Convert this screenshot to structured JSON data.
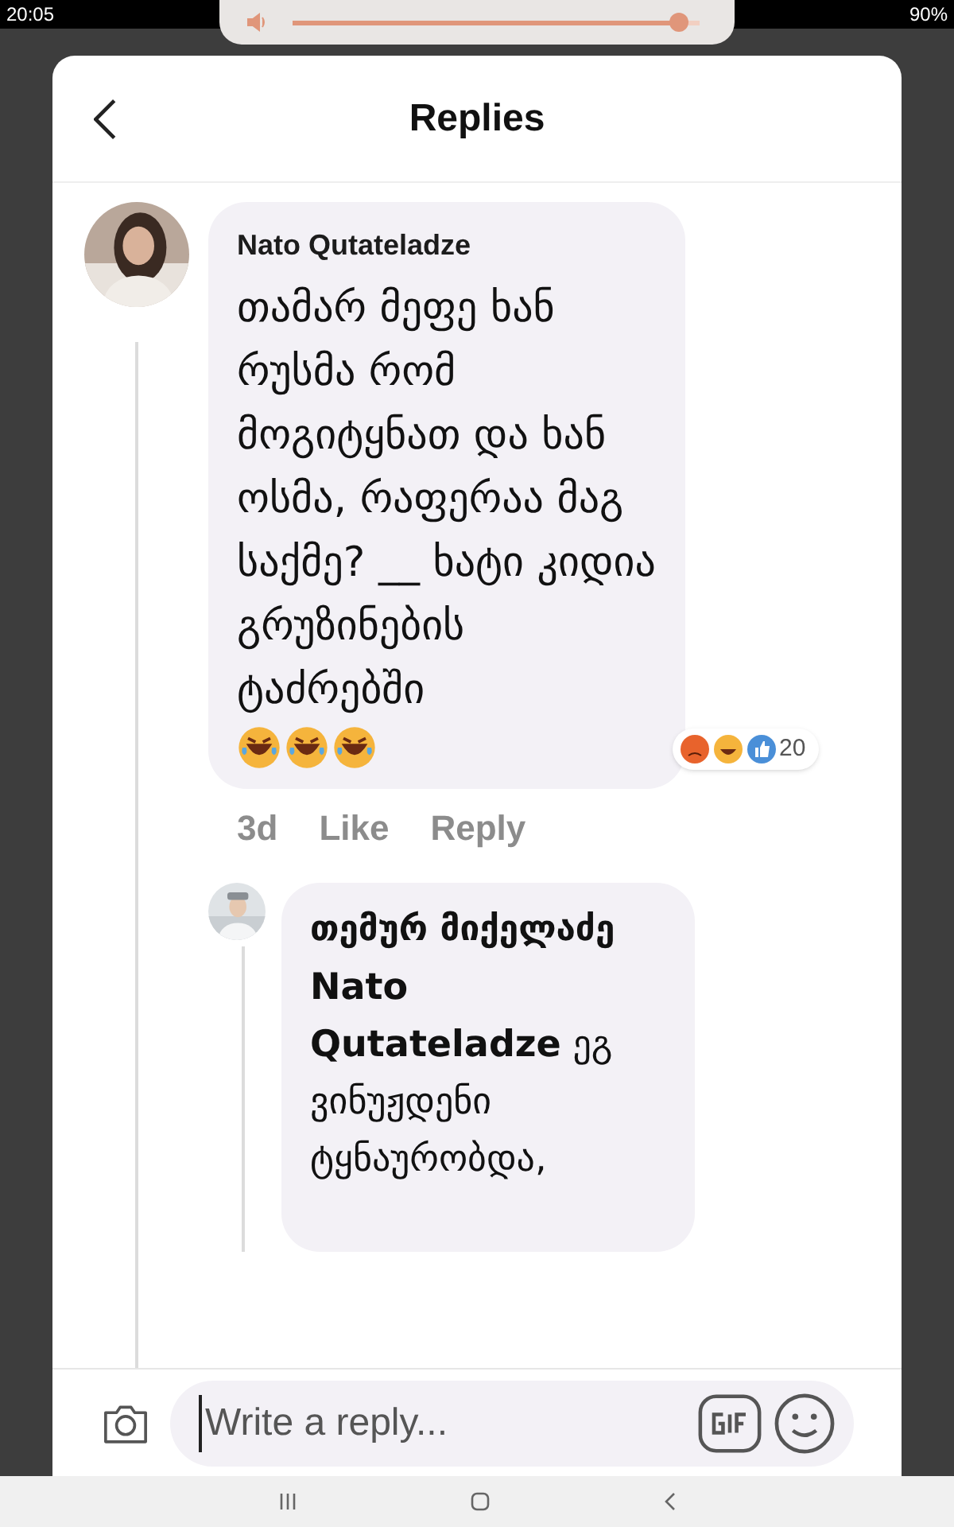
{
  "status_bar": {
    "time": "20:05",
    "battery": "90%"
  },
  "volume_popup": {
    "level": 0.95
  },
  "header": {
    "title": "Replies"
  },
  "comment": {
    "author": "Nato Qutateladze",
    "text": "თამარ მეფე ხან რუსმა რომ მოგიტყნათ და ხან ოსმა, რაფერაა მაგ საქმე? __ ხატი კიდია გრუზინების ტაძრებში",
    "emojis": [
      {
        "kind": "laughing"
      },
      {
        "kind": "laughing"
      },
      {
        "kind": "laughing"
      }
    ],
    "reaction_count": "20",
    "meta": [
      "3d",
      "Like",
      "Reply"
    ]
  },
  "reply": {
    "author": "თემურ მიქელაძე",
    "text": "**Nato Qutateladze** ეგ ვინუჟდენი ტყნაურობდა,"
  },
  "composer": {
    "placeholder": "Write a reply..."
  }
}
